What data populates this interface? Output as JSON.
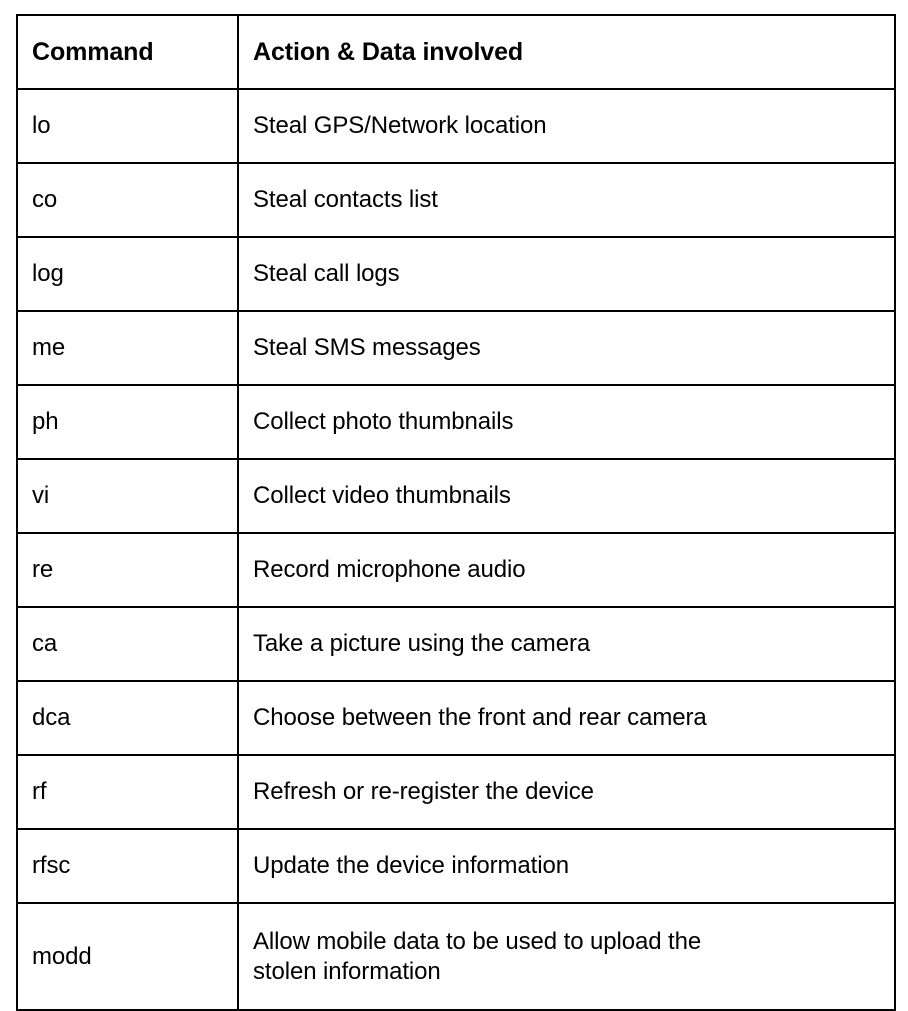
{
  "table": {
    "headers": {
      "command": "Command",
      "action": "Action & Data involved"
    },
    "rows": [
      {
        "command": "lo",
        "action": "Steal GPS/Network location"
      },
      {
        "command": "co",
        "action": "Steal contacts list"
      },
      {
        "command": "log",
        "action": "Steal call logs"
      },
      {
        "command": "me",
        "action": "Steal SMS messages"
      },
      {
        "command": "ph",
        "action": "Collect photo thumbnails"
      },
      {
        "command": "vi",
        "action": "Collect video thumbnails"
      },
      {
        "command": "re",
        "action": "Record microphone audio"
      },
      {
        "command": "ca",
        "action": "Take a picture using the camera"
      },
      {
        "command": "dca",
        "action": "Choose between the front and rear camera"
      },
      {
        "command": "rf",
        "action": "Refresh or re-register the device"
      },
      {
        "command": "rfsc",
        "action": "Update the device information"
      },
      {
        "command": "modd",
        "action": "Allow mobile data to be used to upload the stolen information",
        "action_line1": "Allow mobile data to be used to upload the",
        "action_line2": "stolen information",
        "tall": true
      }
    ]
  },
  "colors": {
    "border": "#000000",
    "text": "#000000",
    "background": "#ffffff"
  }
}
